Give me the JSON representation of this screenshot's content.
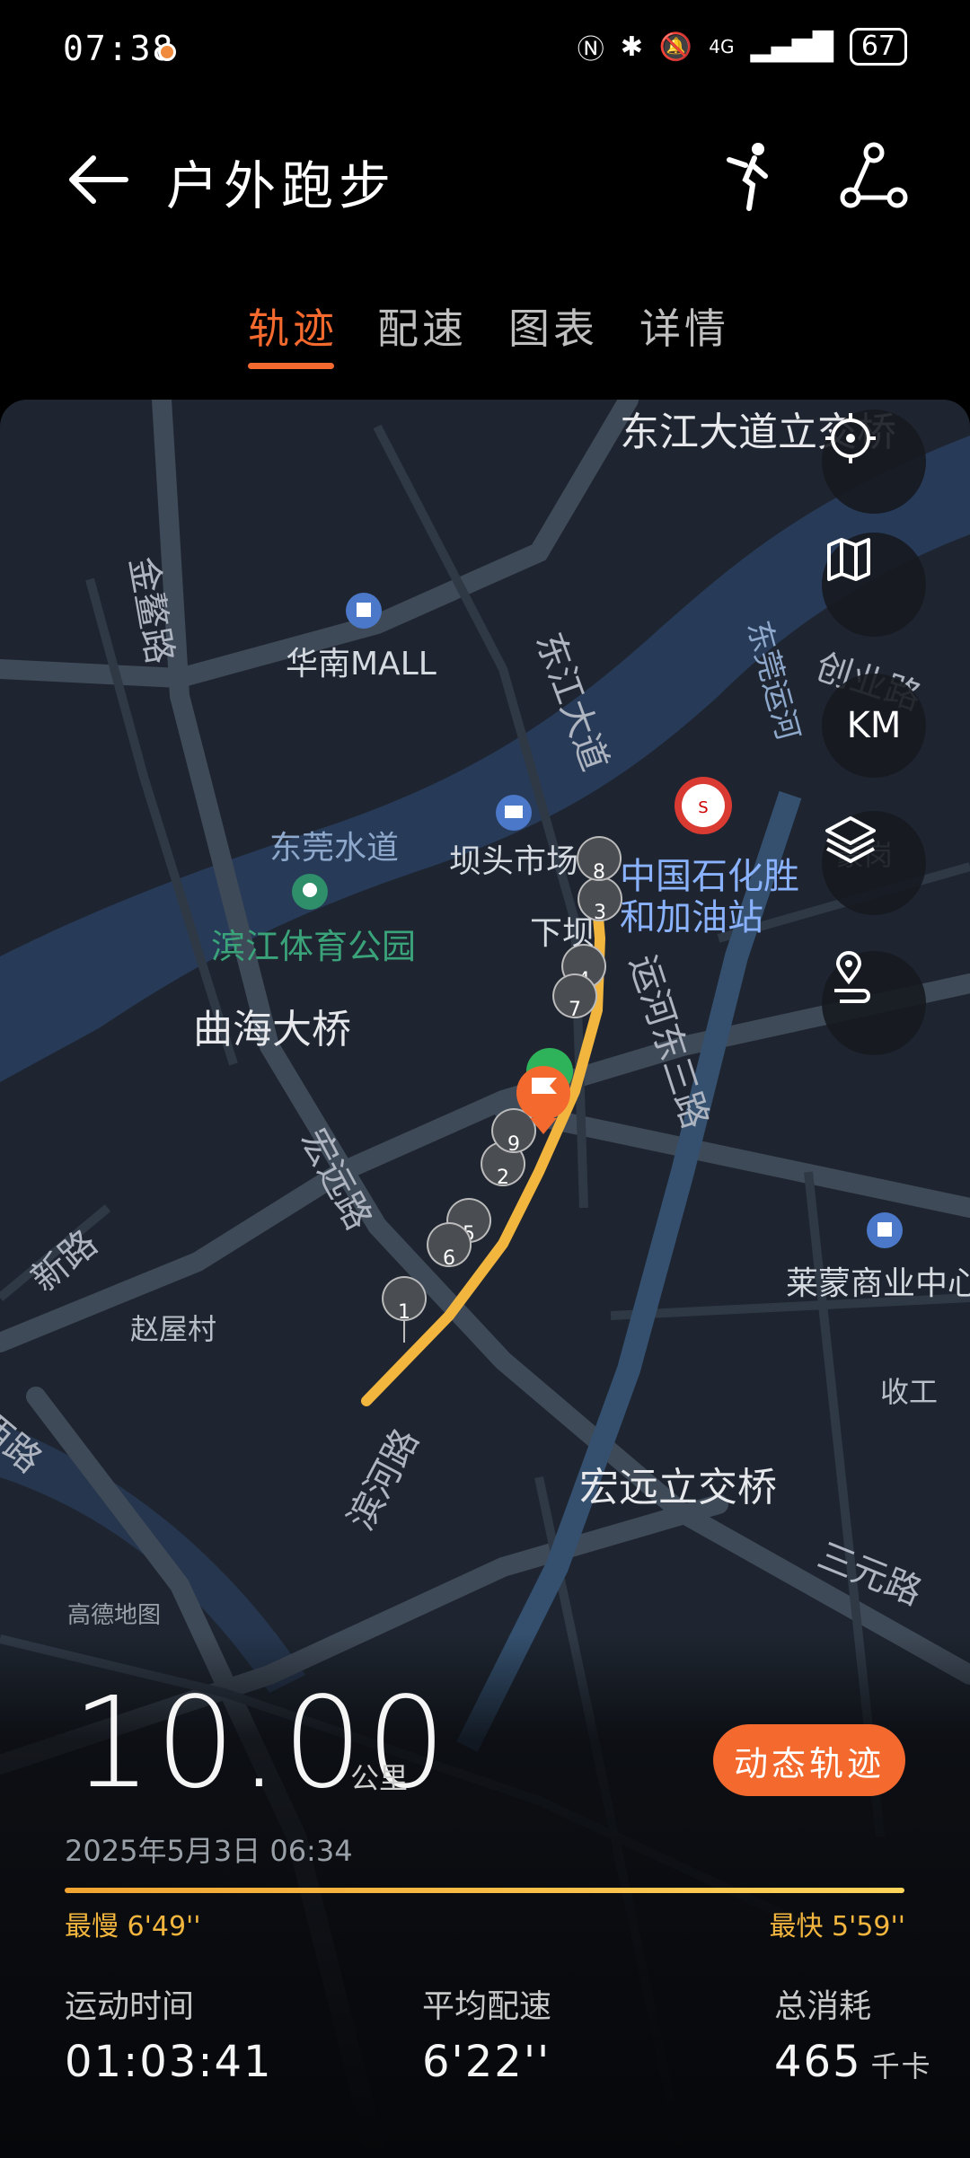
{
  "status_bar": {
    "time": "07:38",
    "network": "4G",
    "battery": "67"
  },
  "header": {
    "title": "户外跑步"
  },
  "tabs": [
    {
      "label": "轨迹",
      "active": true
    },
    {
      "label": "配速",
      "active": false
    },
    {
      "label": "图表",
      "active": false
    },
    {
      "label": "详情",
      "active": false
    }
  ],
  "map": {
    "labels": {
      "dongjiang_interchange": "东江大道立交桥",
      "jinao_road": "金鳌路",
      "huanan_mall": "华南MALL",
      "dongjiang_avenue": "东江大道",
      "dongguan_canal": "东莞运河",
      "chuangye_road": "创业路",
      "dongguan_waterway": "东莞水道",
      "batou_market": "坝头市场",
      "sinopec": "中国石化胜\n和加油站",
      "haogang": "豪岗",
      "binjiang_park": "滨江体育公园",
      "xiaba": "下坝",
      "qu_hai_bridge": "曲海大桥",
      "yunhe_east_road": "运河东三路",
      "hongyuan_road": "宏远路",
      "laimeng_center": "莱蒙商业中心",
      "xin_road": "新路",
      "zhaowu_village": "赵屋村",
      "shougong": "收工",
      "xi_road": "西路",
      "binhe_road": "滨河路",
      "hongyuan_interchange": "宏远立交桥",
      "sanyuan_road": "三元路",
      "amap_credit": "高德地图"
    },
    "km_markers": [
      "1",
      "2",
      "3",
      "4",
      "5",
      "6",
      "7",
      "8",
      "9"
    ],
    "controls": {
      "locate": "locate-icon",
      "map_type": "map-icon",
      "unit": "KM",
      "layers": "layers-icon",
      "route_points": "route-pin-icon"
    },
    "route_color": "#f2b53e"
  },
  "summary": {
    "distance": "10.00",
    "distance_unit": "公里",
    "dynamic_track_button": "动态轨迹",
    "datetime": "2025年5月3日 06:34",
    "slowest": "最慢 6'49''",
    "fastest": "最快 5'59''",
    "stats": [
      {
        "label": "运动时间",
        "value": "01:03:41",
        "unit": ""
      },
      {
        "label": "平均配速",
        "value": "6'22''",
        "unit": ""
      },
      {
        "label": "总消耗",
        "value": "465",
        "unit": "千卡"
      }
    ]
  },
  "colors": {
    "accent": "#f46a2e",
    "pace_bar": "#f2b53e",
    "map_bg": "#1e2530"
  }
}
